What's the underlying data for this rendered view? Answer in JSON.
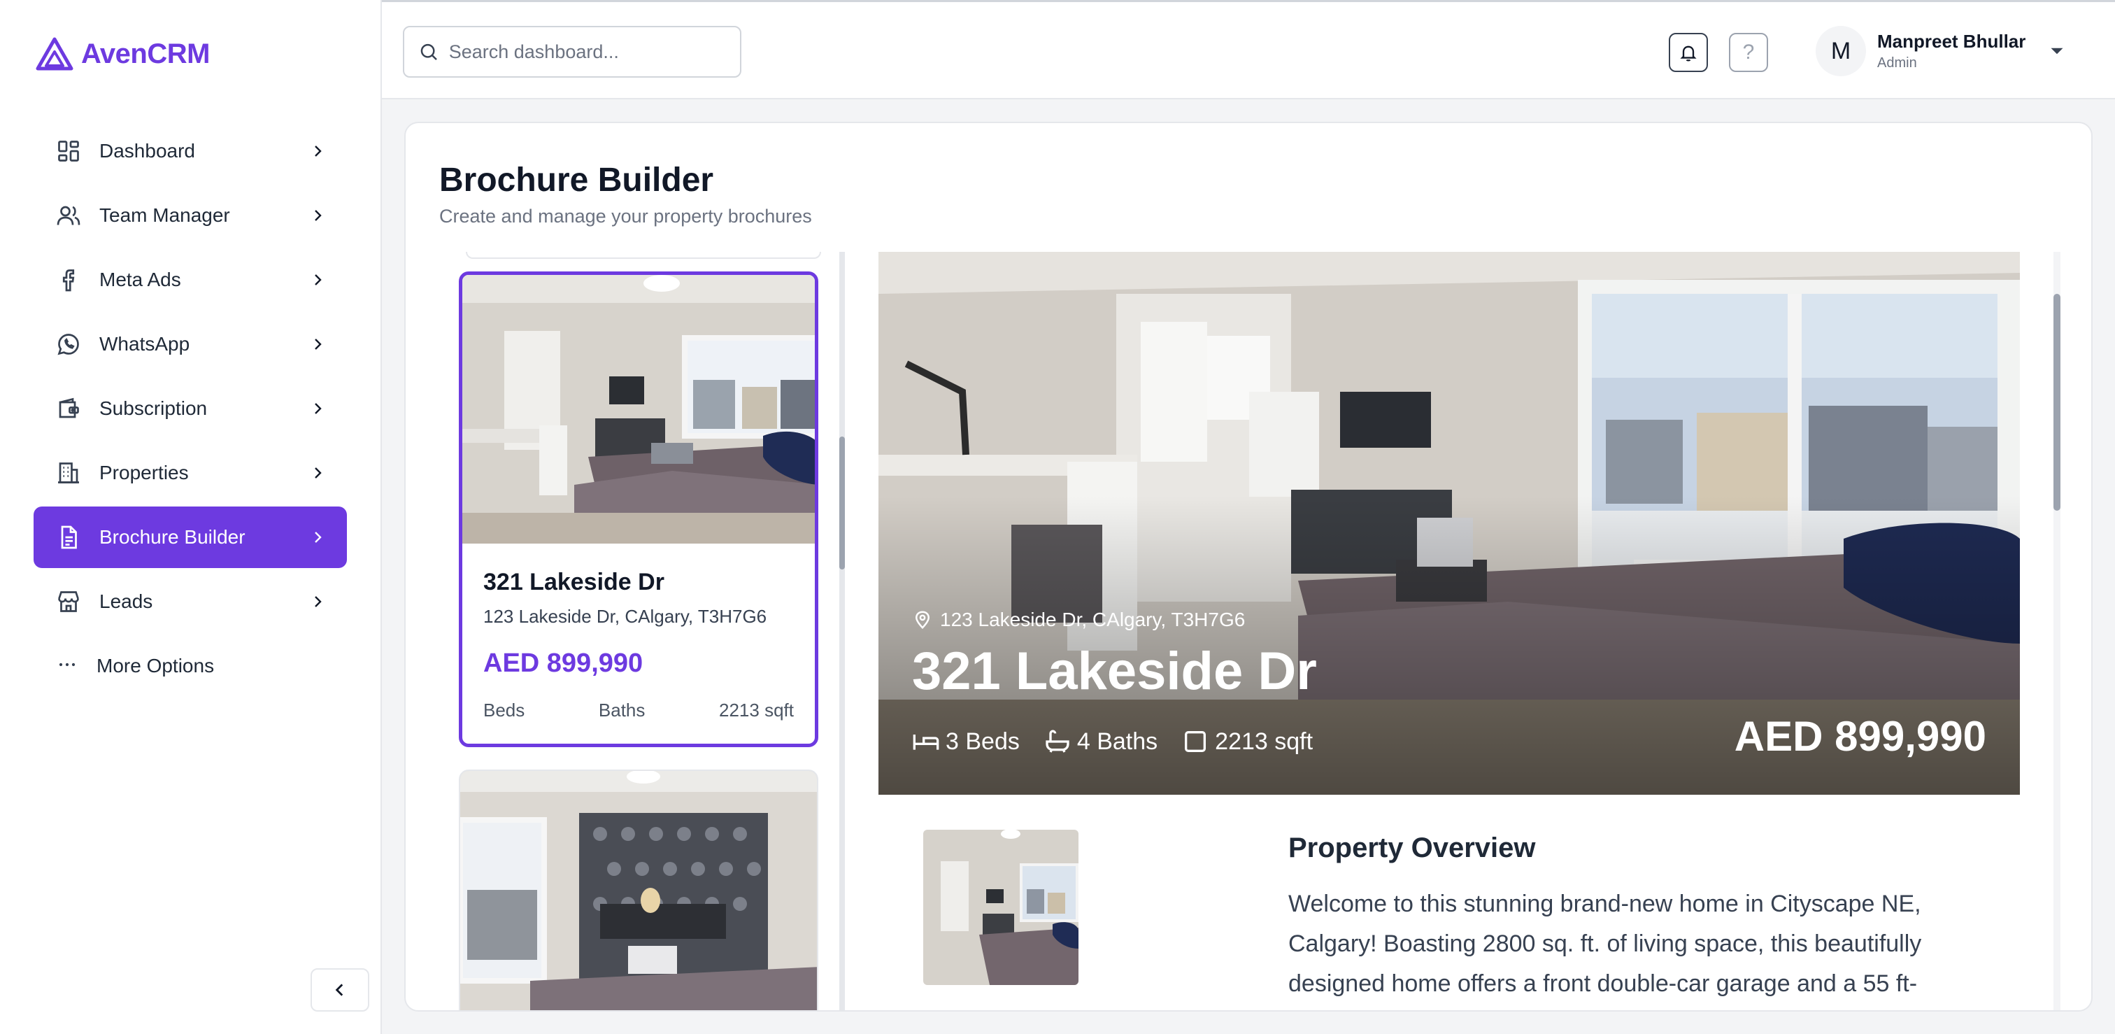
{
  "app": {
    "name": "AvenCRM",
    "brand_color": "#6d3ae0"
  },
  "sidebar": {
    "items": [
      {
        "label": "Dashboard",
        "icon": "grid-icon"
      },
      {
        "label": "Team Manager",
        "icon": "users-icon"
      },
      {
        "label": "Meta Ads",
        "icon": "facebook-icon"
      },
      {
        "label": "WhatsApp",
        "icon": "whatsapp-icon"
      },
      {
        "label": "Subscription",
        "icon": "wallet-icon"
      },
      {
        "label": "Properties",
        "icon": "building-icon"
      },
      {
        "label": "Brochure Builder",
        "icon": "document-icon",
        "active": true
      },
      {
        "label": "Leads",
        "icon": "store-icon"
      }
    ],
    "more_label": "More Options"
  },
  "header": {
    "search_placeholder": "Search dashboard...",
    "help_label": "?",
    "user": {
      "initial": "M",
      "name": "Manpreet Bhullar",
      "role": "Admin"
    }
  },
  "page": {
    "title": "Brochure Builder",
    "subtitle": "Create and manage your property brochures"
  },
  "properties": [
    {
      "title": "321 Lakeside Dr",
      "address": "123 Lakeside Dr, CAlgary, T3H7G6",
      "price": "AED 899,990",
      "beds_label": "Beds",
      "baths_label": "Baths",
      "area": "2213 sqft"
    }
  ],
  "preview": {
    "address": "123 Lakeside Dr, CAlgary, T3H7G6",
    "title": "321 Lakeside Dr",
    "beds": "3 Beds",
    "baths": "4 Baths",
    "area": "2213 sqft",
    "price": "AED 899,990",
    "overview_title": "Property Overview",
    "overview_text": "Welcome to this stunning brand-new home in Cityscape NE, Calgary! Boasting 2800 sq. ft. of living space, this beautifully designed home offers a front double-car garage and a 55 ft-"
  }
}
